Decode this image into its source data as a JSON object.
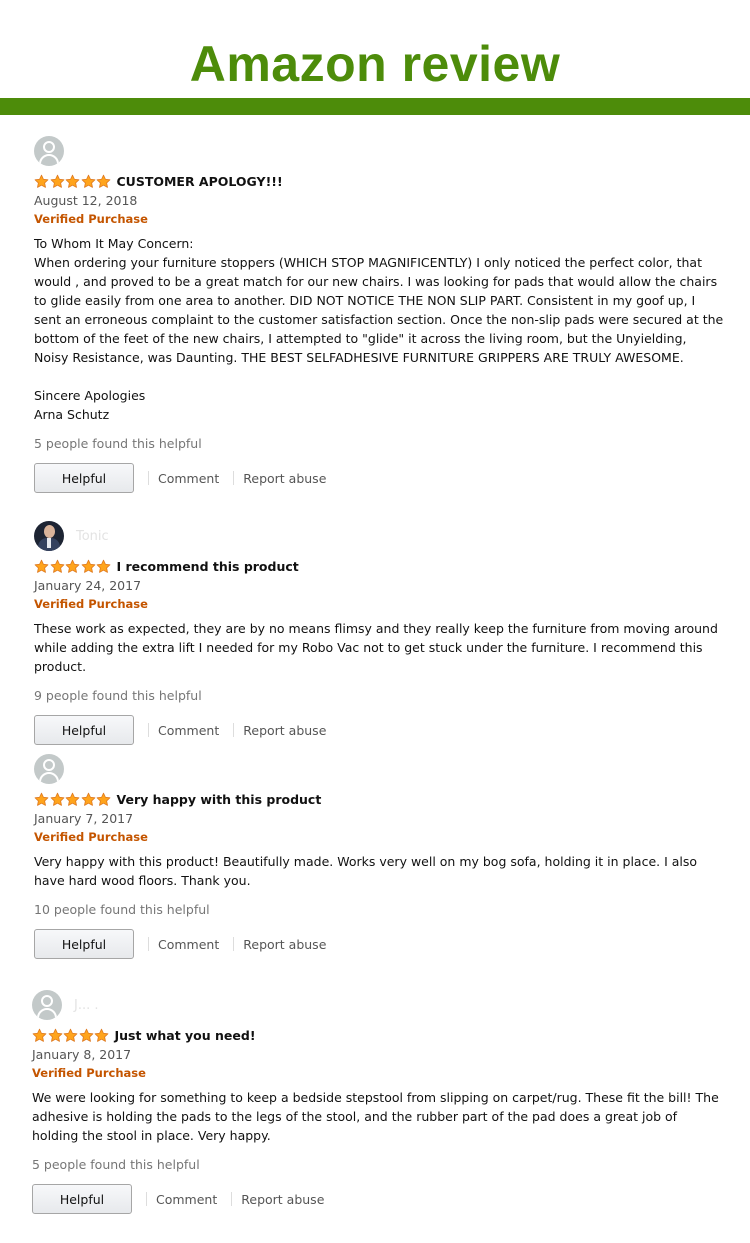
{
  "header": {
    "title": "Amazon review",
    "title_color": "#4d8c0a",
    "bar_color": "#4d8c0a"
  },
  "colors": {
    "star_fill": "#ffa41c",
    "star_stroke": "#de7921",
    "verified": "#c45500"
  },
  "labels": {
    "helpful_button": "Helpful",
    "comment": "Comment",
    "report_abuse": "Report abuse"
  },
  "reviews": [
    {
      "avatar": "default-avatar-icon",
      "reviewer": "",
      "rating": 5,
      "title": "CUSTOMER APOLOGY!!!",
      "date": "August 12, 2018",
      "verified": "Verified Purchase",
      "body": "To Whom It May Concern:\nWhen ordering your furniture stoppers (WHICH STOP MAGNIFICENTLY) I only noticed the perfect color, that would , and proved to be a great match for our new chairs. I was looking for pads that would allow the chairs to glide easily from one area to another. DID NOT NOTICE THE NON SLIP PART. Consistent in my goof up, I sent an erroneous complaint to the customer satisfaction section. Once the non-slip pads were secured at the bottom of the feet of the new chairs, I attempted to \"glide\" it across the living room, but the Unyielding, Noisy Resistance, was Daunting. THE BEST SELFADHESIVE FURNITURE GRIPPERS ARE TRULY AWESOME.\n\nSincere Apologies\nArna Schutz",
      "helpful_count": "5 people found this helpful"
    },
    {
      "avatar": "profile-photo-avatar",
      "reviewer": "Tonic",
      "rating": 5,
      "title": "I recommend this product",
      "date": "January 24, 2017",
      "verified": "Verified Purchase",
      "body": "These work as expected, they are by no means flimsy and they really keep the furniture from moving around while adding the extra lift I needed for my Robo Vac not to get stuck under the furniture. I recommend this product.",
      "helpful_count": "9 people found this helpful"
    },
    {
      "avatar": "default-avatar-icon",
      "reviewer": "",
      "rating": 5,
      "title": "Very happy with this product",
      "date": "January 7, 2017",
      "verified": "Verified Purchase",
      "body": "Very happy with this product! Beautifully made. Works very well on my bog sofa, holding it in place. I also have hard wood floors. Thank you.",
      "helpful_count": "10 people found this helpful"
    },
    {
      "avatar": "default-avatar-icon",
      "reviewer": "J... .",
      "rating": 5,
      "title": "Just what you need!",
      "date": "January 8, 2017",
      "verified": "Verified Purchase",
      "body": "We were looking for something to keep a bedside stepstool from slipping on carpet/rug. These fit the bill! The adhesive is holding the pads to the legs of the stool, and the rubber part of the pad does a great job of holding the stool in place. Very happy.",
      "helpful_count": "5 people found this helpful"
    }
  ]
}
